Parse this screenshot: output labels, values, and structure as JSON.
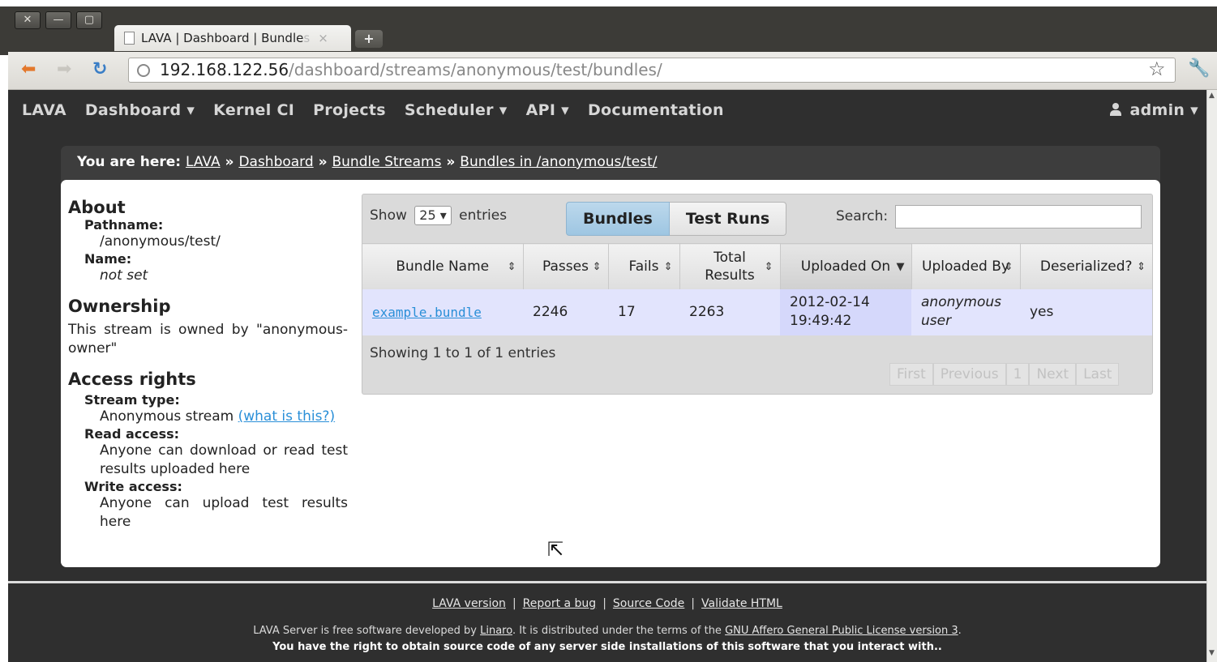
{
  "browser": {
    "window_buttons": [
      "✕",
      "—",
      "▢"
    ],
    "tab_title": "LAVA | Dashboard | Bundle",
    "tab_title_fade": "s",
    "tab_close": "×",
    "new_tab": "+",
    "url_host": "192.168.122.56",
    "url_path": "/dashboard/streams/anonymous/test/bundles/"
  },
  "topnav": {
    "items": [
      "LAVA",
      "Dashboard ▾",
      "Kernel CI",
      "Projects",
      "Scheduler ▾",
      "API ▾",
      "Documentation"
    ],
    "user": "admin ▾"
  },
  "breadcrumb": {
    "prefix": "You are here:",
    "crumbs": [
      "LAVA",
      "Dashboard",
      "Bundle Streams",
      "Bundles in /anonymous/test/"
    ],
    "separator": "»"
  },
  "sidebar": {
    "about_title": "About",
    "pathname_label": "Pathname:",
    "pathname_value": "/anonymous/test/",
    "name_label": "Name:",
    "name_value": "not set",
    "ownership_title": "Ownership",
    "ownership_text": "This stream is owned by \"anonymous-owner\"",
    "access_title": "Access rights",
    "stream_type_label": "Stream type:",
    "stream_type_value": "Anonymous stream",
    "stream_type_link": "(what is this?)",
    "read_label": "Read access:",
    "read_value": "Anyone can download or read test results uploaded here",
    "write_label": "Write access:",
    "write_value": "Anyone can upload test results here"
  },
  "table": {
    "show_label": "Show",
    "page_size": "25 ▾",
    "entries_label": "entries",
    "tabs": [
      "Bundles",
      "Test Runs"
    ],
    "search_label": "Search:",
    "search_value": "",
    "columns": [
      "Bundle Name",
      "Passes",
      "Fails",
      "Total Results",
      "Uploaded On",
      "Uploaded By",
      "Deserialized?"
    ],
    "rows": [
      {
        "bundle_name": "example.bundle",
        "passes": "2246",
        "fails": "17",
        "total": "2263",
        "uploaded_on": "2012-02-14 19:49:42",
        "uploaded_by": "anonymous user",
        "deserialized": "yes"
      }
    ],
    "info": "Showing 1 to 1 of 1 entries",
    "paging": [
      "First",
      "Previous",
      "1",
      "Next",
      "Last"
    ]
  },
  "footer": {
    "links": [
      "LAVA version",
      "Report a bug",
      "Source Code",
      "Validate HTML"
    ],
    "license_prefix": "LAVA Server is free software developed by",
    "license_linaro": "Linaro",
    "license_mid": ". It is distributed under the terms of the",
    "license_link": "GNU Affero General Public License version 3",
    "license_end": ".",
    "notice": "You have the right to obtain source code of any server side installations of this software that you interact with.."
  }
}
